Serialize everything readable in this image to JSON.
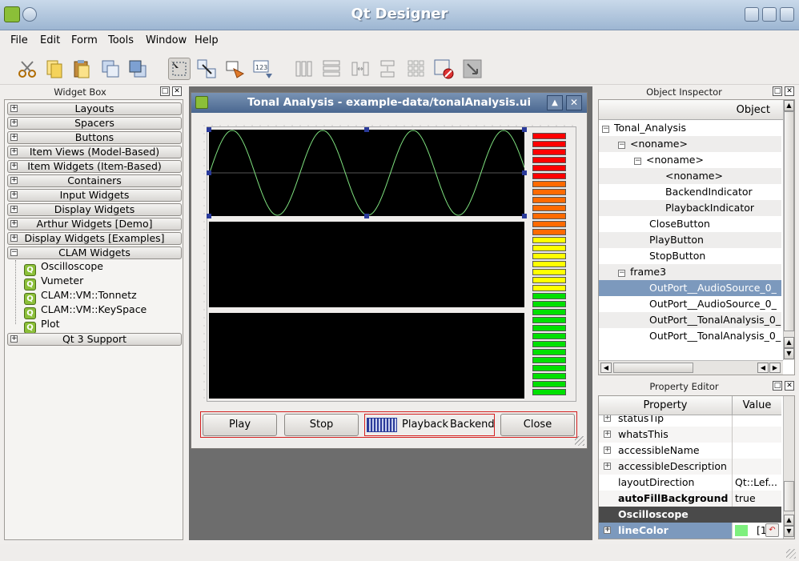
{
  "app": {
    "title": "Qt Designer"
  },
  "menu": [
    "File",
    "Edit",
    "Form",
    "Tools",
    "Window",
    "Help"
  ],
  "toolbar": {
    "icons": [
      "cut-icon",
      "copy-icon",
      "paste-icon",
      "send-to-back-icon",
      "bring-to-front-icon",
      "edit-widgets-icon",
      "edit-signals-icon",
      "edit-buddies-icon",
      "edit-tab-order-icon",
      "layout-horizontal-icon",
      "layout-vertical-icon",
      "layout-splitter-horizontal-icon",
      "layout-splitter-vertical-icon",
      "layout-grid-icon",
      "break-layout-icon",
      "adjust-size-icon"
    ]
  },
  "widget_box": {
    "title": "Widget Box",
    "categories": [
      "Layouts",
      "Spacers",
      "Buttons",
      "Item Views (Model-Based)",
      "Item Widgets (Item-Based)",
      "Containers",
      "Input Widgets",
      "Display Widgets",
      "Arthur Widgets [Demo]",
      "Display Widgets [Examples]",
      "CLAM Widgets"
    ],
    "clam_items": [
      "Oscilloscope",
      "Vumeter",
      "CLAM::VM::Tonnetz",
      "CLAM::VM::KeySpace",
      "Plot"
    ],
    "last_category": "Qt 3 Support"
  },
  "form": {
    "title": "Tonal Analysis - example-data/tonalAnalysis.ui",
    "buttons": {
      "play": "Play",
      "stop": "Stop",
      "playback": "Playback",
      "backend": "Backend",
      "close": "Close"
    },
    "colors": {
      "wave": "#7ee07e",
      "meter_red": "#ff0000",
      "meter_orange": "#ff6a00",
      "meter_yellow": "#ffff00",
      "meter_green": "#00e000"
    }
  },
  "object_inspector": {
    "title": "Object Inspector",
    "header": "Object",
    "rows": [
      "Tonal_Analysis",
      "<noname>",
      "<noname>",
      "<noname>",
      "BackendIndicator",
      "PlaybackIndicator",
      "CloseButton",
      "PlayButton",
      "StopButton",
      "frame3",
      "OutPort__AudioSource_0_",
      "OutPort__AudioSource_0_",
      "OutPort__TonalAnalysis_0_",
      "OutPort__TonalAnalysis_0_"
    ]
  },
  "property_editor": {
    "title": "Property Editor",
    "headers": {
      "property": "Property",
      "value": "Value"
    },
    "rows": [
      {
        "name": "statusTip",
        "value": ""
      },
      {
        "name": "whatsThis",
        "value": ""
      },
      {
        "name": "accessibleName",
        "value": ""
      },
      {
        "name": "accessibleDescription",
        "value": ""
      },
      {
        "name": "layoutDirection",
        "value": "Qt::Lef..."
      },
      {
        "name": "autoFillBackground",
        "value": "true"
      },
      {
        "name": "Oscilloscope",
        "value": ""
      },
      {
        "name": "lineColor",
        "value": "[1"
      }
    ],
    "line_color": "#7ef07e"
  }
}
